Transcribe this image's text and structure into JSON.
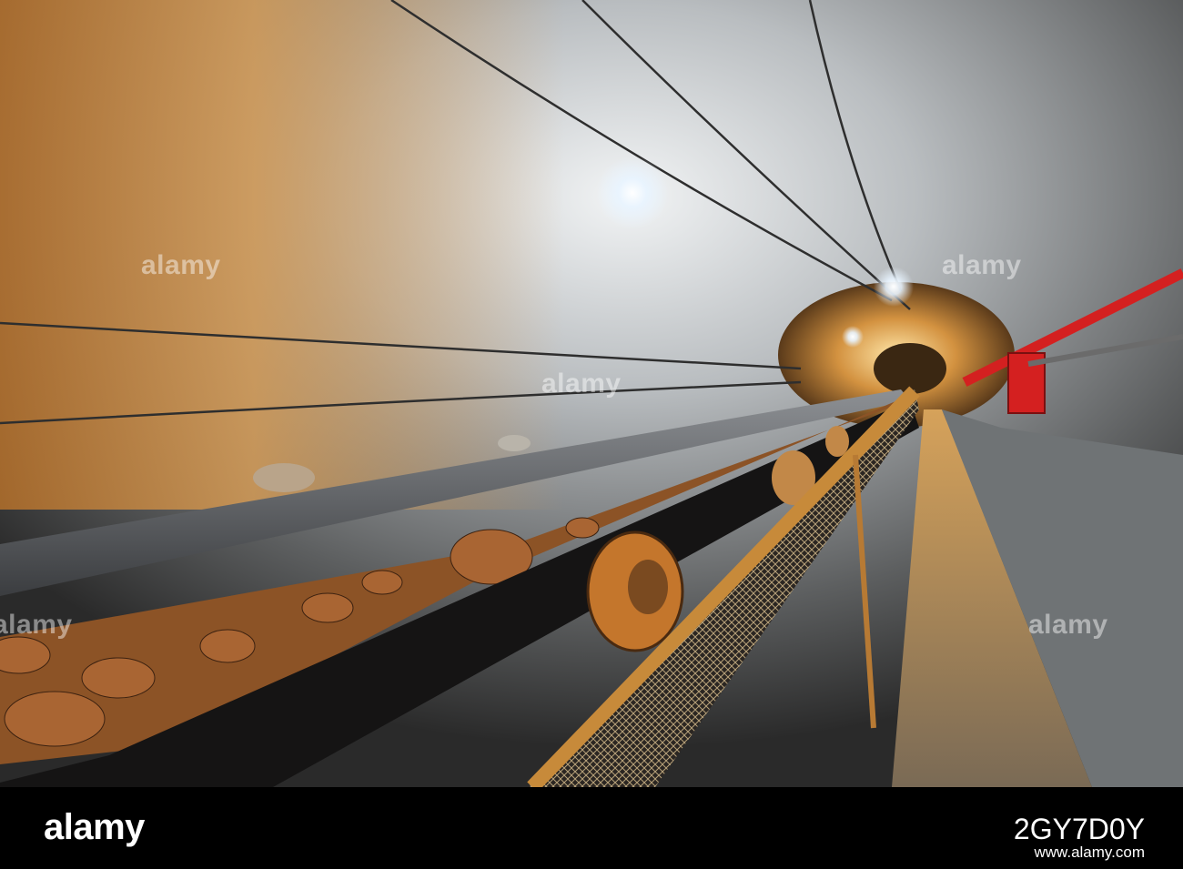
{
  "photo": {
    "subject": "underground-mine-tunnel-conveyor",
    "watermark_text": "alamy"
  },
  "footer": {
    "brand": "alamy",
    "image_id": "2GY7D0Y",
    "url": "www.alamy.com"
  },
  "colors": {
    "rock_warm": "#c9883a",
    "rock_cool": "#bfc3c6",
    "belt": "#4a4c50",
    "ore": "#9a5a2c",
    "railing": "#c78a3a",
    "red_box": "#d42020"
  }
}
